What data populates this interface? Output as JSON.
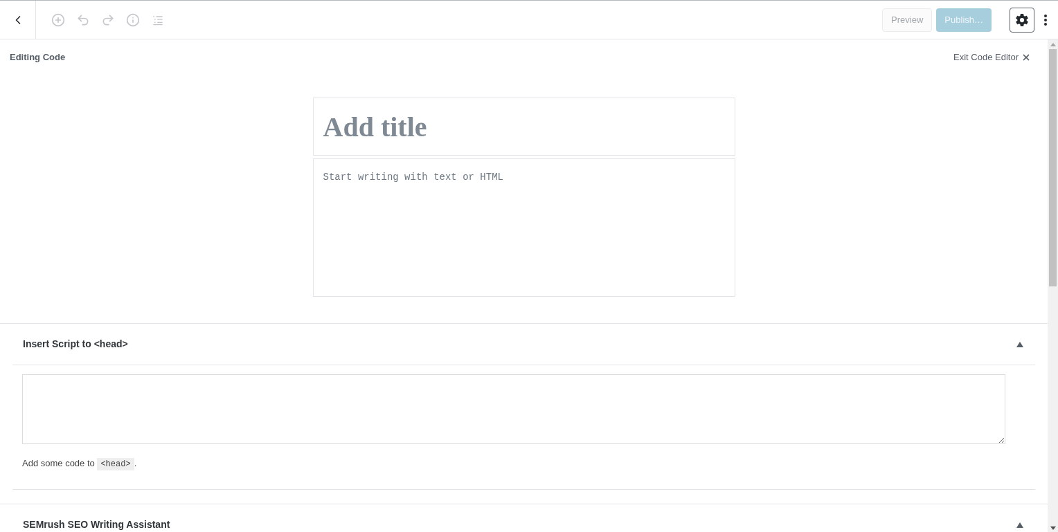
{
  "toolbar": {
    "tools": [
      {
        "kind": "add",
        "disabled": true
      },
      {
        "kind": "undo",
        "disabled": true
      },
      {
        "kind": "redo",
        "disabled": true
      },
      {
        "kind": "info",
        "disabled": true
      },
      {
        "kind": "outline",
        "disabled": true
      }
    ],
    "preview": {
      "label": "Preview",
      "disabled": true
    },
    "publish": {
      "label": "Publish…",
      "disabled": true
    },
    "settings": {
      "selected": true
    }
  },
  "mode_bar": {
    "title": "Editing Code",
    "exit_label": "Exit Code Editor"
  },
  "editor": {
    "title_placeholder": "Add title",
    "content_placeholder": "Start writing with text or HTML"
  },
  "panels": [
    {
      "title": "Insert Script to <head>",
      "expanded": true,
      "help_before": "Add some code to",
      "help_code": "<head>",
      "help_after": "."
    },
    {
      "title": "SEMrush SEO Writing Assistant",
      "expanded": true
    }
  ]
}
